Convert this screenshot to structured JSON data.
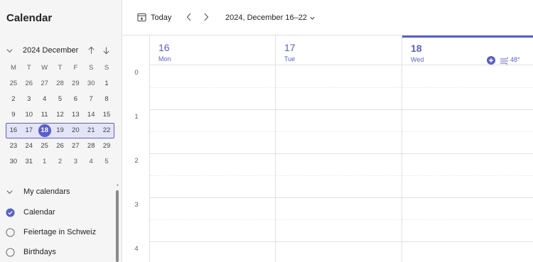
{
  "sidebar": {
    "title": "Calendar",
    "mini_calendar": {
      "month_label": "2024 December",
      "weekdays": [
        "M",
        "T",
        "W",
        "T",
        "F",
        "S",
        "S"
      ],
      "weeks": [
        [
          "25",
          "26",
          "27",
          "28",
          "29",
          "30",
          "1"
        ],
        [
          "2",
          "3",
          "4",
          "5",
          "6",
          "7",
          "8"
        ],
        [
          "9",
          "10",
          "11",
          "12",
          "13",
          "14",
          "15"
        ],
        [
          "16",
          "17",
          "18",
          "19",
          "20",
          "21",
          "22"
        ],
        [
          "23",
          "24",
          "25",
          "26",
          "27",
          "28",
          "29"
        ],
        [
          "30",
          "31",
          "1",
          "2",
          "3",
          "4",
          "5"
        ]
      ],
      "selected_week_index": 3,
      "today": "18"
    },
    "my_calendars": {
      "label": "My calendars",
      "items": [
        {
          "label": "Calendar",
          "checked": true
        },
        {
          "label": "Feiertage in Schweiz",
          "checked": false
        },
        {
          "label": "Birthdays",
          "checked": false
        }
      ]
    }
  },
  "toolbar": {
    "today_label": "Today",
    "range_label": "2024, December 16–22"
  },
  "week_view": {
    "days": [
      {
        "num": "16",
        "name": "Mon",
        "today": false
      },
      {
        "num": "17",
        "name": "Tue",
        "today": false
      },
      {
        "num": "18",
        "name": "Wed",
        "today": true,
        "weather": "48°"
      }
    ],
    "hours": [
      "0",
      "1",
      "2",
      "3",
      "4"
    ]
  },
  "colors": {
    "accent": "#5b5fc7",
    "selected_week_bg": "#e3e4f7",
    "sidebar_bg": "#f5f5f5"
  }
}
